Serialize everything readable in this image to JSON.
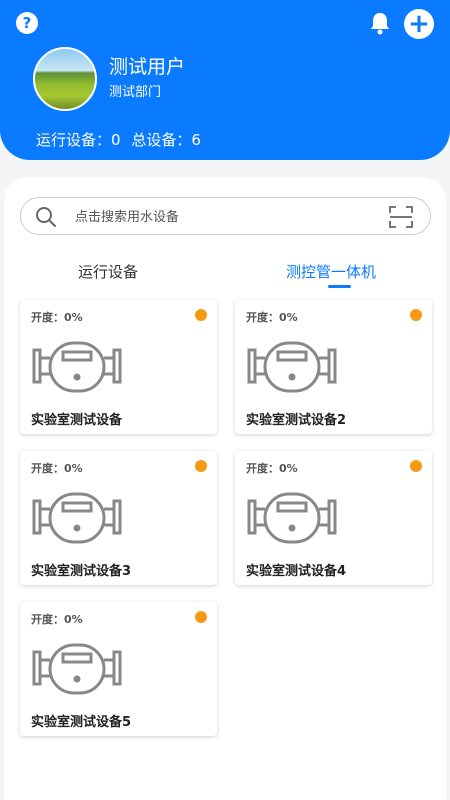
{
  "header": {
    "help_icon": "question-circle-icon",
    "bell_icon": "bell-icon",
    "add_icon": "plus-circle-icon",
    "user_name": "测试用户",
    "department": "测试部门",
    "running_devices_text": "运行设备：0",
    "total_devices_text": "总设备：6",
    "accent_color": "#0a7bff"
  },
  "search": {
    "placeholder": "点击搜索用水设备",
    "search_icon": "search-icon",
    "scan_icon": "scan-icon"
  },
  "tabs": [
    {
      "label": "运行设备",
      "active": false
    },
    {
      "label": "测控管一体机",
      "active": true
    }
  ],
  "devices": [
    {
      "opening": "开度：0%",
      "name": "实验室测试设备",
      "status_color": "#f59a12"
    },
    {
      "opening": "开度：0%",
      "name": "实验室测试设备2",
      "status_color": "#f59a12"
    },
    {
      "opening": "开度：0%",
      "name": "实验室测试设备3",
      "status_color": "#f59a12"
    },
    {
      "opening": "开度：0%",
      "name": "实验室测试设备4",
      "status_color": "#f59a12"
    },
    {
      "opening": "开度：0%",
      "name": "实验室测试设备5",
      "status_color": "#f59a12"
    }
  ]
}
